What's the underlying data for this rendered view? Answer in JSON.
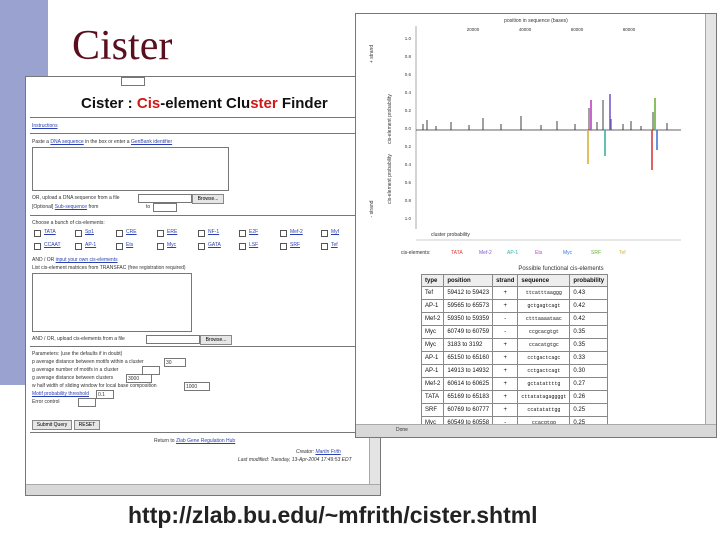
{
  "slide": {
    "title": "Cister",
    "url": "http://zlab.bu.edu/~mfrith/cister.shtml"
  },
  "left_window": {
    "heading_pre": "Cister : ",
    "heading_red1": "Cis",
    "heading_mid": "-element Clu",
    "heading_red2": "ster",
    "heading_post": " Finder",
    "instructions_link": "Instructions",
    "paste_pre": "Paste a",
    "paste_link": "DNA sequence",
    "paste_mid": "in the box or enter a",
    "paste_link2": "GenBank identifier",
    "upload_label": "OR, upload a DNA sequence from a file",
    "browse": "Browse...",
    "repeat_pre": "[Optional]",
    "repeat_link": "Sub-sequence",
    "repeat_mid": "from",
    "repeat_to": "to",
    "choose_label": "Choose a bunch of cis-elements:",
    "elements_row1": [
      "TATA",
      "Sp1",
      "CRE",
      "ERE",
      "NF-1",
      "E2F",
      "Mef-2",
      "Myf"
    ],
    "elements_row2": [
      "CCAAT",
      "AP-1",
      "Ets",
      "Myc",
      "GATA",
      "LSF",
      "SRF",
      "Tef"
    ],
    "and_or_pre": "AND / OR",
    "and_or_link": "input your own cis-elements",
    "list_label": "List cis-element matrices from TRANSFAC (free registration required)",
    "and_or_upload": "AND / OR, upload cis-elements from a file",
    "params_label": "Parameters: (use the defaults if in doubt)",
    "param1": "p average distance between motifs within a cluster",
    "param1_val": "30",
    "param2": "g average number of motifs in a cluster",
    "param3": "g average distance between clusters",
    "param3_val": "3000",
    "param4": "w half width of sliding window for local base composition",
    "param4_val": "1000",
    "param5": "Motif probability threshold",
    "param5_val": "0.1",
    "param6": "Error control",
    "submit": "Submit Query",
    "reset": "RESET",
    "return_pre": "Return to",
    "return_link": "Zlab Gene Regulation Hub",
    "creator_pre": "Creator:",
    "creator_link": "Martin Frith",
    "modified": "Last modified: Tuesday, 13-Apr-2004 17:49:53 EDT"
  },
  "right_window": {
    "plot_title": "position in sequence (bases)",
    "x_ticks": [
      "20000",
      "40000",
      "60000",
      "80000"
    ],
    "plus_label": "+ strand",
    "minus_label": "- strand",
    "ylabel_top": "cis-element probability",
    "ylabel_bottom": "cis-element probability",
    "y_ticks_top": [
      "1.0",
      "0.8",
      "0.6",
      "0.4",
      "0.2",
      "0.0"
    ],
    "y_ticks_bottom": [
      "0.2",
      "0.4",
      "0.6",
      "0.8",
      "1.0"
    ],
    "cluster_label": "cluster probability",
    "legend_label": "cis-elements:",
    "legend": [
      {
        "name": "TATA",
        "color": "#d93a3a"
      },
      {
        "name": "Mef-2",
        "color": "#7a5cc9"
      },
      {
        "name": "AP-1",
        "color": "#3ab0a0"
      },
      {
        "name": "Ets",
        "color": "#c040c0"
      },
      {
        "name": "Myc",
        "color": "#3a7ad9"
      },
      {
        "name": "SRF",
        "color": "#6ab03a"
      },
      {
        "name": "Tef",
        "color": "#d9b03a"
      }
    ],
    "table_caption": "Possible functional cis-elements",
    "columns": [
      "type",
      "position",
      "strand",
      "sequence",
      "probability"
    ],
    "rows": [
      [
        "Tef",
        "59412 to 59423",
        "+",
        "ttcatttaaggg",
        "0.43"
      ],
      [
        "AP-1",
        "59565 to 65573",
        "+",
        "gctgagtcagt",
        "0.42"
      ],
      [
        "Mef-2",
        "59350 to 59359",
        "-",
        "ctttaaaataac",
        "0.42"
      ],
      [
        "Myc",
        "60749 to 60759",
        "-",
        "ccgcacgtgt",
        "0.35"
      ],
      [
        "Myc",
        "3183 to 3192",
        "+",
        "ccacatgtgc",
        "0.35"
      ],
      [
        "AP-1",
        "65150 to 65160",
        "+",
        "cctgactcagc",
        "0.33"
      ],
      [
        "AP-1",
        "14913 to 14932",
        "+",
        "cctgactcagt",
        "0.30"
      ],
      [
        "Mef-2",
        "60614 to 60625",
        "+",
        "gctatattttg",
        "0.27"
      ],
      [
        "TATA",
        "65169 to 65183",
        "+",
        "cttatatagaggggt",
        "0.26"
      ],
      [
        "SRF",
        "60769 to 60777",
        "+",
        "ccatatattgg",
        "0.25"
      ],
      [
        "Myc",
        "60549 to 60558",
        "-",
        "ccacgtgg",
        "0.25"
      ]
    ],
    "status_text": "Done"
  }
}
